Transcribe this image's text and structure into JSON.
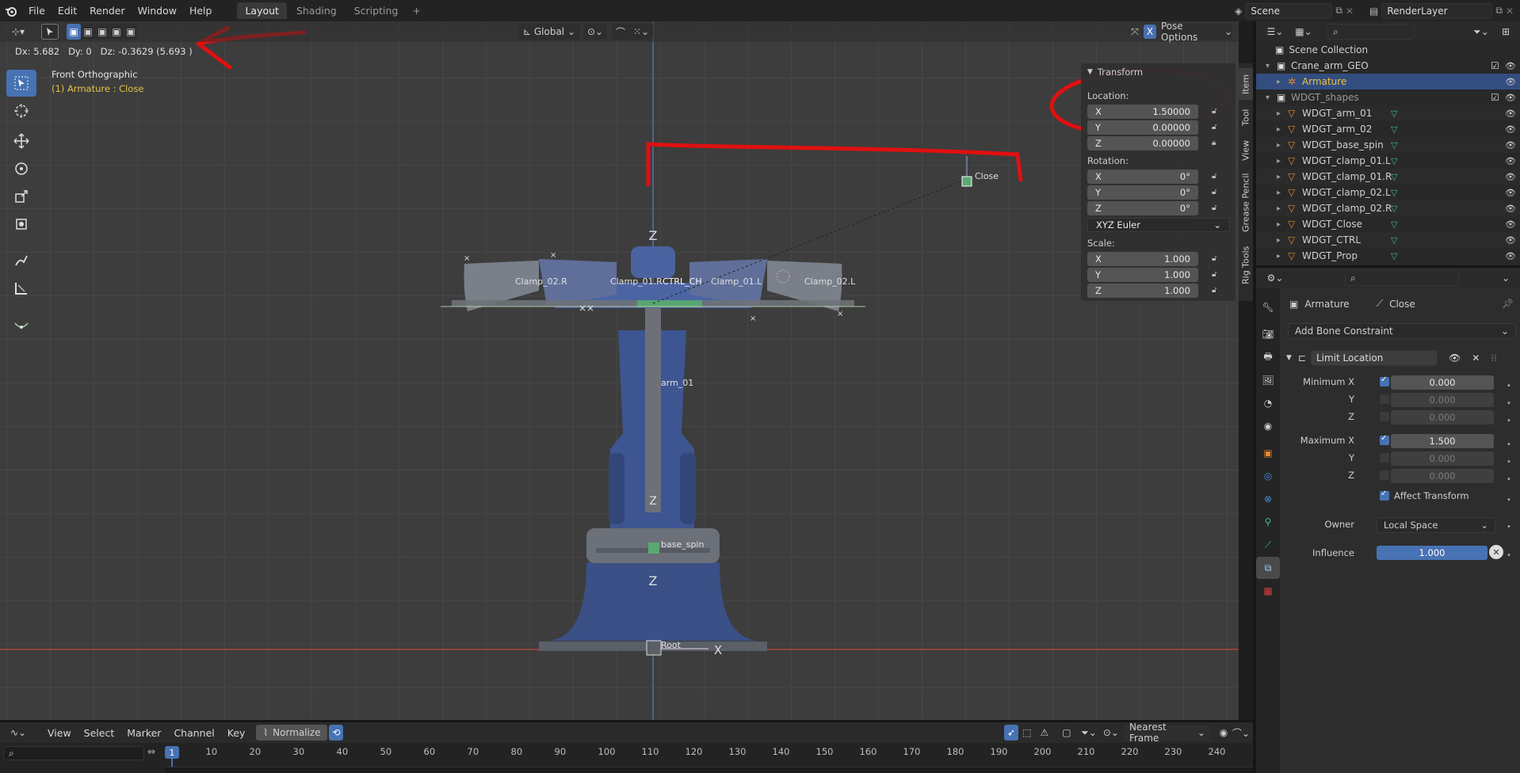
{
  "topbar": {
    "menus": [
      "File",
      "Edit",
      "Render",
      "Window",
      "Help"
    ],
    "workspaces": [
      "Layout",
      "Shading",
      "Scripting"
    ],
    "active_workspace": "Layout",
    "add_workspace": "+",
    "scene": "Scene",
    "render_layer": "RenderLayer"
  },
  "viewport": {
    "status_readout": "Dx: 5.682   Dy: 0   Dz: -0.3629 (5.693 )",
    "view_name": "Front Orthographic",
    "context_line": "(1) Armature : Close",
    "transform_orientation": "Global",
    "pose_options": "Pose Options",
    "x_toggle": "X"
  },
  "bones": {
    "close": "Close",
    "clamp_02_r": "Clamp_02.R",
    "clamp_01_r": "Clamp_01.R",
    "ctrl_overlap": "CTRL_CH",
    "clamp_01_l": "Clamp_01.L",
    "clamp_02_l": "Clamp_02.L",
    "arm_01": "arm_01",
    "base_spin": "base_spin",
    "root": "Root"
  },
  "npanel": {
    "section": "Transform",
    "location_label": "Location:",
    "location": {
      "x": "1.50000",
      "y": "0.00000",
      "z": "0.00000"
    },
    "rotation_label": "Rotation:",
    "rotation": {
      "x": "0°",
      "y": "0°",
      "z": "0°"
    },
    "rotation_mode": "XYZ Euler",
    "scale_label": "Scale:",
    "scale": {
      "x": "1.000",
      "y": "1.000",
      "z": "1.000"
    },
    "axis_x": "X",
    "axis_y": "Y",
    "axis_z": "Z",
    "tabs": [
      "Item",
      "Tool",
      "View",
      "Grease Pencil",
      "Rig Tools"
    ]
  },
  "outliner": {
    "root": "Scene Collection",
    "items": [
      {
        "label": "Crane_arm_GEO",
        "type": "collection"
      },
      {
        "label": "Armature",
        "type": "armature",
        "selected": true
      },
      {
        "label": "WDGT_shapes",
        "type": "collection"
      },
      {
        "label": "WDGT_arm_01",
        "type": "mesh"
      },
      {
        "label": "WDGT_arm_02",
        "type": "mesh"
      },
      {
        "label": "WDGT_base_spin",
        "type": "mesh"
      },
      {
        "label": "WDGT_clamp_01.L",
        "type": "mesh"
      },
      {
        "label": "WDGT_clamp_01.R",
        "type": "mesh"
      },
      {
        "label": "WDGT_clamp_02.L",
        "type": "mesh"
      },
      {
        "label": "WDGT_clamp_02.R",
        "type": "mesh"
      },
      {
        "label": "WDGT_Close",
        "type": "mesh"
      },
      {
        "label": "WDGT_CTRL",
        "type": "mesh"
      },
      {
        "label": "WDGT_Prop",
        "type": "mesh"
      }
    ]
  },
  "properties": {
    "breadcrumb_object": "Armature",
    "breadcrumb_bone": "Close",
    "add_constraint": "Add Bone Constraint",
    "constraint_name": "Limit Location",
    "minimum_x_label": "Minimum X",
    "minimum_x": "0.000",
    "min_y_label": "Y",
    "min_y": "0.000",
    "min_z_label": "Z",
    "min_z": "0.000",
    "maximum_x_label": "Maximum X",
    "maximum_x": "1.500",
    "max_y_label": "Y",
    "max_y": "0.000",
    "max_z_label": "Z",
    "max_z": "0.000",
    "affect_transform": "Affect Transform",
    "owner_label": "Owner",
    "owner_value": "Local Space",
    "influence_label": "Influence",
    "influence_value": "1.000"
  },
  "timeline": {
    "menus": [
      "View",
      "Select",
      "Marker",
      "Channel",
      "Key"
    ],
    "normalize": "Normalize",
    "snapping": "Nearest Frame",
    "current_frame": "1",
    "ticks": [
      "10",
      "20",
      "30",
      "40",
      "50",
      "60",
      "70",
      "80",
      "90",
      "100",
      "110",
      "120",
      "130",
      "140",
      "150",
      "160",
      "170",
      "180",
      "190",
      "200",
      "210",
      "220",
      "230",
      "240"
    ]
  },
  "colors": {
    "accent": "#4772b3",
    "annotation": "#e01010",
    "context_text": "#e2c34a"
  }
}
